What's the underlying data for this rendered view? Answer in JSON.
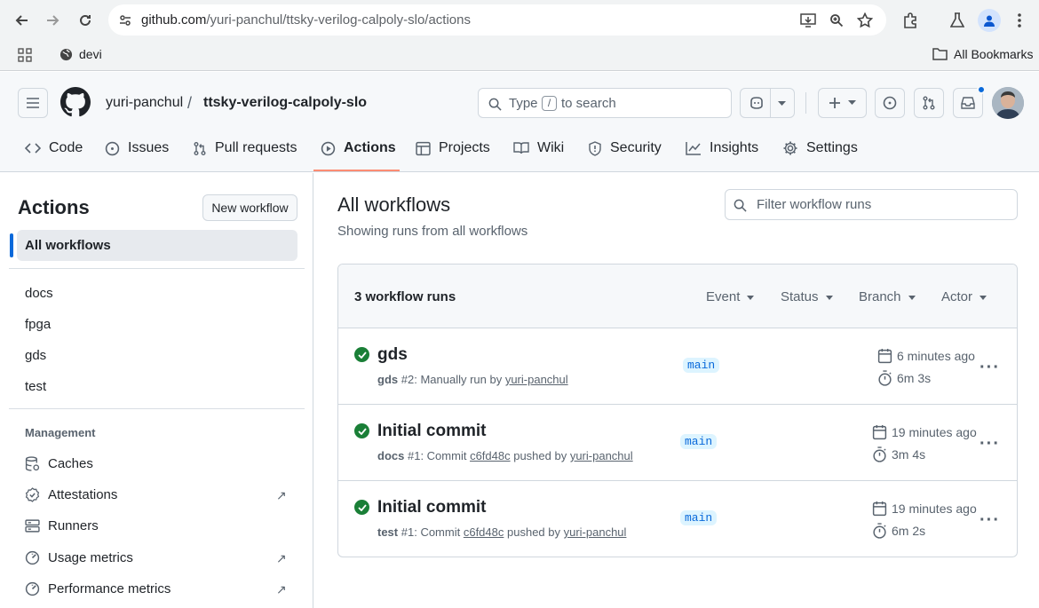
{
  "browser": {
    "url_domain": "github.com",
    "url_path": "/yuri-panchul/ttsky-verilog-calpoly-slo/actions",
    "bookmark_folder": "devi",
    "all_bookmarks": "All Bookmarks"
  },
  "header": {
    "owner": "yuri-panchul",
    "separator": "/",
    "repo": "ttsky-verilog-calpoly-slo",
    "search_prefix": "Type",
    "search_key": "/",
    "search_suffix": "to search"
  },
  "tabs": [
    {
      "label": "Code",
      "icon": "code-icon"
    },
    {
      "label": "Issues",
      "icon": "issue-icon"
    },
    {
      "label": "Pull requests",
      "icon": "pull-request-icon"
    },
    {
      "label": "Actions",
      "icon": "play-icon"
    },
    {
      "label": "Projects",
      "icon": "table-icon"
    },
    {
      "label": "Wiki",
      "icon": "book-icon"
    },
    {
      "label": "Security",
      "icon": "shield-icon"
    },
    {
      "label": "Insights",
      "icon": "graph-icon"
    },
    {
      "label": "Settings",
      "icon": "gear-icon"
    }
  ],
  "sidebar": {
    "title": "Actions",
    "new_workflow": "New workflow",
    "all_workflows": "All workflows",
    "workflows": [
      "docs",
      "fpga",
      "gds",
      "test"
    ],
    "management_title": "Management",
    "management": [
      {
        "label": "Caches",
        "icon": "database-icon"
      },
      {
        "label": "Attestations",
        "icon": "verified-icon"
      },
      {
        "label": "Runners",
        "icon": "server-icon"
      },
      {
        "label": "Usage metrics",
        "icon": "meter-icon"
      },
      {
        "label": "Performance metrics",
        "icon": "meter-icon"
      }
    ]
  },
  "main": {
    "title": "All workflows",
    "subtitle": "Showing runs from all workflows",
    "filter_placeholder": "Filter workflow runs",
    "runs_count": "3 workflow runs",
    "filters": [
      "Event",
      "Status",
      "Branch",
      "Actor"
    ],
    "runs": [
      {
        "title": "gds",
        "workflow": "gds",
        "number": "#2",
        "desc": ": Manually run by ",
        "commit": "",
        "actor": "yuri-panchul",
        "branch": "main",
        "ago": "6 minutes ago",
        "duration": "6m 3s"
      },
      {
        "title": "Initial commit",
        "workflow": "docs",
        "number": "#1",
        "desc": ": Commit ",
        "commit": "c6fd48c",
        "actor": "yuri-panchul",
        "branch": "main",
        "ago": "19 minutes ago",
        "duration": "3m 4s"
      },
      {
        "title": "Initial commit",
        "workflow": "test",
        "number": "#1",
        "desc": ": Commit ",
        "commit": "c6fd48c",
        "actor": "yuri-panchul",
        "branch": "main",
        "ago": "19 minutes ago",
        "duration": "6m 2s"
      }
    ]
  },
  "colors": {
    "accent": "#fd8c73",
    "success": "#1a7f37",
    "link": "#0969da"
  }
}
